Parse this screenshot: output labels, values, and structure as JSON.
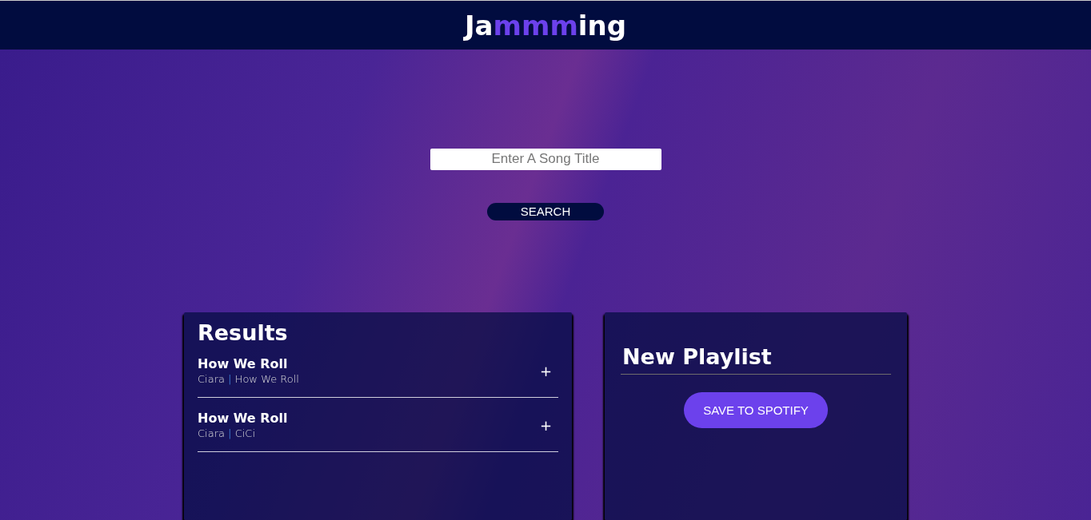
{
  "header": {
    "logo": [
      {
        "text": "Ja",
        "highlight": false
      },
      {
        "text": "mmm",
        "highlight": true
      },
      {
        "text": "ing",
        "highlight": false
      }
    ]
  },
  "search": {
    "placeholder": "Enter A Song Title",
    "button": "SEARCH"
  },
  "results": {
    "title": "Results",
    "tracks": [
      {
        "name": "How We Roll",
        "artist": "Ciara",
        "separator": "|",
        "album": "How We Roll",
        "action": "+"
      },
      {
        "name": "How We Roll",
        "artist": "Ciara",
        "separator": "|",
        "album": "CiCi",
        "action": "+"
      }
    ]
  },
  "playlist": {
    "name": "New Playlist",
    "button": "SAVE TO SPOTIFY"
  }
}
